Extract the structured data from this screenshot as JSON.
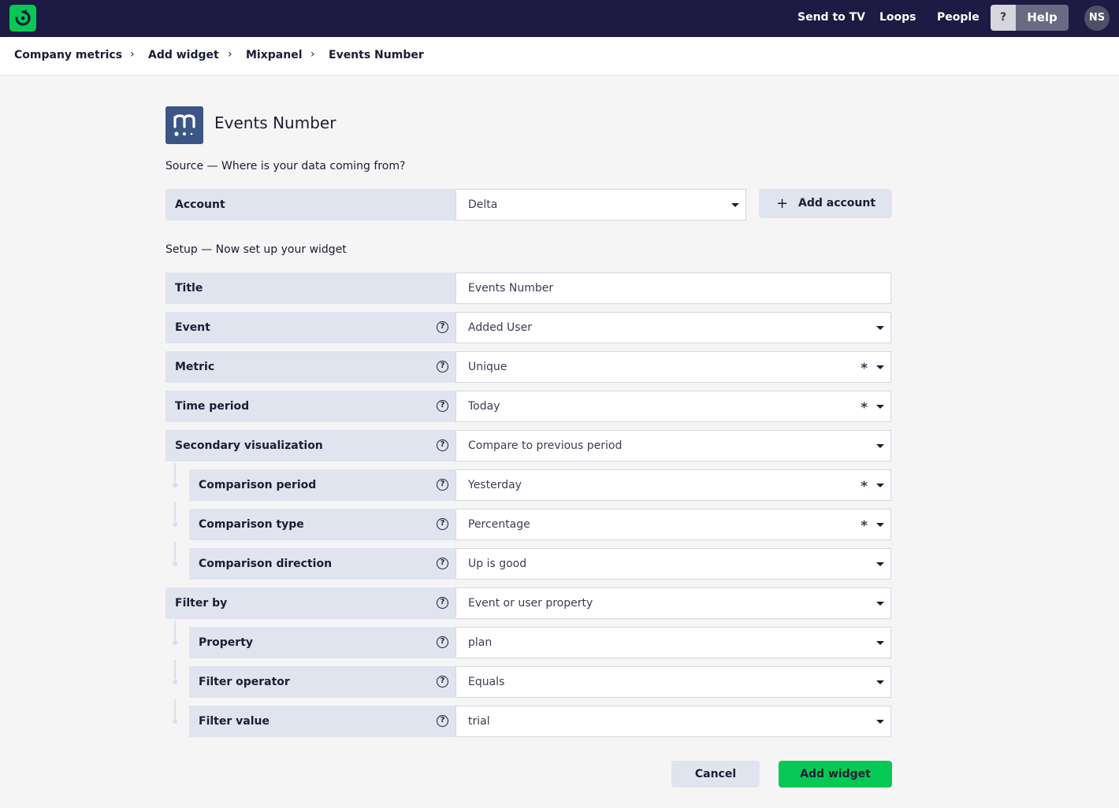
{
  "topbar": {
    "logo_icon": "geckoboard-logo-icon",
    "nav": [
      "Send to TV",
      "Loops",
      "People"
    ],
    "help_icon": "?",
    "help_label": "Help",
    "avatar_initials": "NS"
  },
  "breadcrumb": [
    "Company metrics",
    "Add widget",
    "Mixpanel",
    "Events Number"
  ],
  "header": {
    "source_icon": "mixpanel-logo-icon",
    "title": "Events Number"
  },
  "source_section": {
    "heading": "Source — Where is your data coming from?",
    "account_label": "Account",
    "account_value": "Delta",
    "add_account_label": "Add account"
  },
  "setup_section": {
    "heading": "Setup — Now set up your widget",
    "fields": [
      {
        "label": "Title",
        "value": "Events Number",
        "help": false,
        "dropdown": false,
        "required": false,
        "nested": false
      },
      {
        "label": "Event",
        "value": "Added User",
        "help": true,
        "dropdown": true,
        "required": false,
        "nested": false
      },
      {
        "label": "Metric",
        "value": "Unique",
        "help": true,
        "dropdown": true,
        "required": true,
        "nested": false
      },
      {
        "label": "Time period",
        "value": "Today",
        "help": true,
        "dropdown": true,
        "required": true,
        "nested": false
      },
      {
        "label": "Secondary visualization",
        "value": "Compare to previous period",
        "help": true,
        "dropdown": true,
        "required": false,
        "nested": false
      },
      {
        "label": "Comparison period",
        "value": "Yesterday",
        "help": true,
        "dropdown": true,
        "required": true,
        "nested": true
      },
      {
        "label": "Comparison type",
        "value": "Percentage",
        "help": true,
        "dropdown": true,
        "required": true,
        "nested": true
      },
      {
        "label": "Comparison direction",
        "value": "Up is good",
        "help": true,
        "dropdown": true,
        "required": false,
        "nested": true
      },
      {
        "label": "Filter by",
        "value": "Event or user property",
        "help": true,
        "dropdown": true,
        "required": false,
        "nested": false
      },
      {
        "label": "Property",
        "value": "plan",
        "help": true,
        "dropdown": true,
        "required": false,
        "nested": true
      },
      {
        "label": "Filter operator",
        "value": "Equals",
        "help": true,
        "dropdown": true,
        "required": false,
        "nested": true
      },
      {
        "label": "Filter value",
        "value": "trial",
        "help": true,
        "dropdown": true,
        "required": false,
        "nested": true
      }
    ]
  },
  "actions": {
    "cancel": "Cancel",
    "submit": "Add widget"
  },
  "colors": {
    "topbar": "#1d1a44",
    "brand_green": "#06c955",
    "label_bg": "#e0e4ee",
    "mixpanel_blue": "#3c5585"
  }
}
